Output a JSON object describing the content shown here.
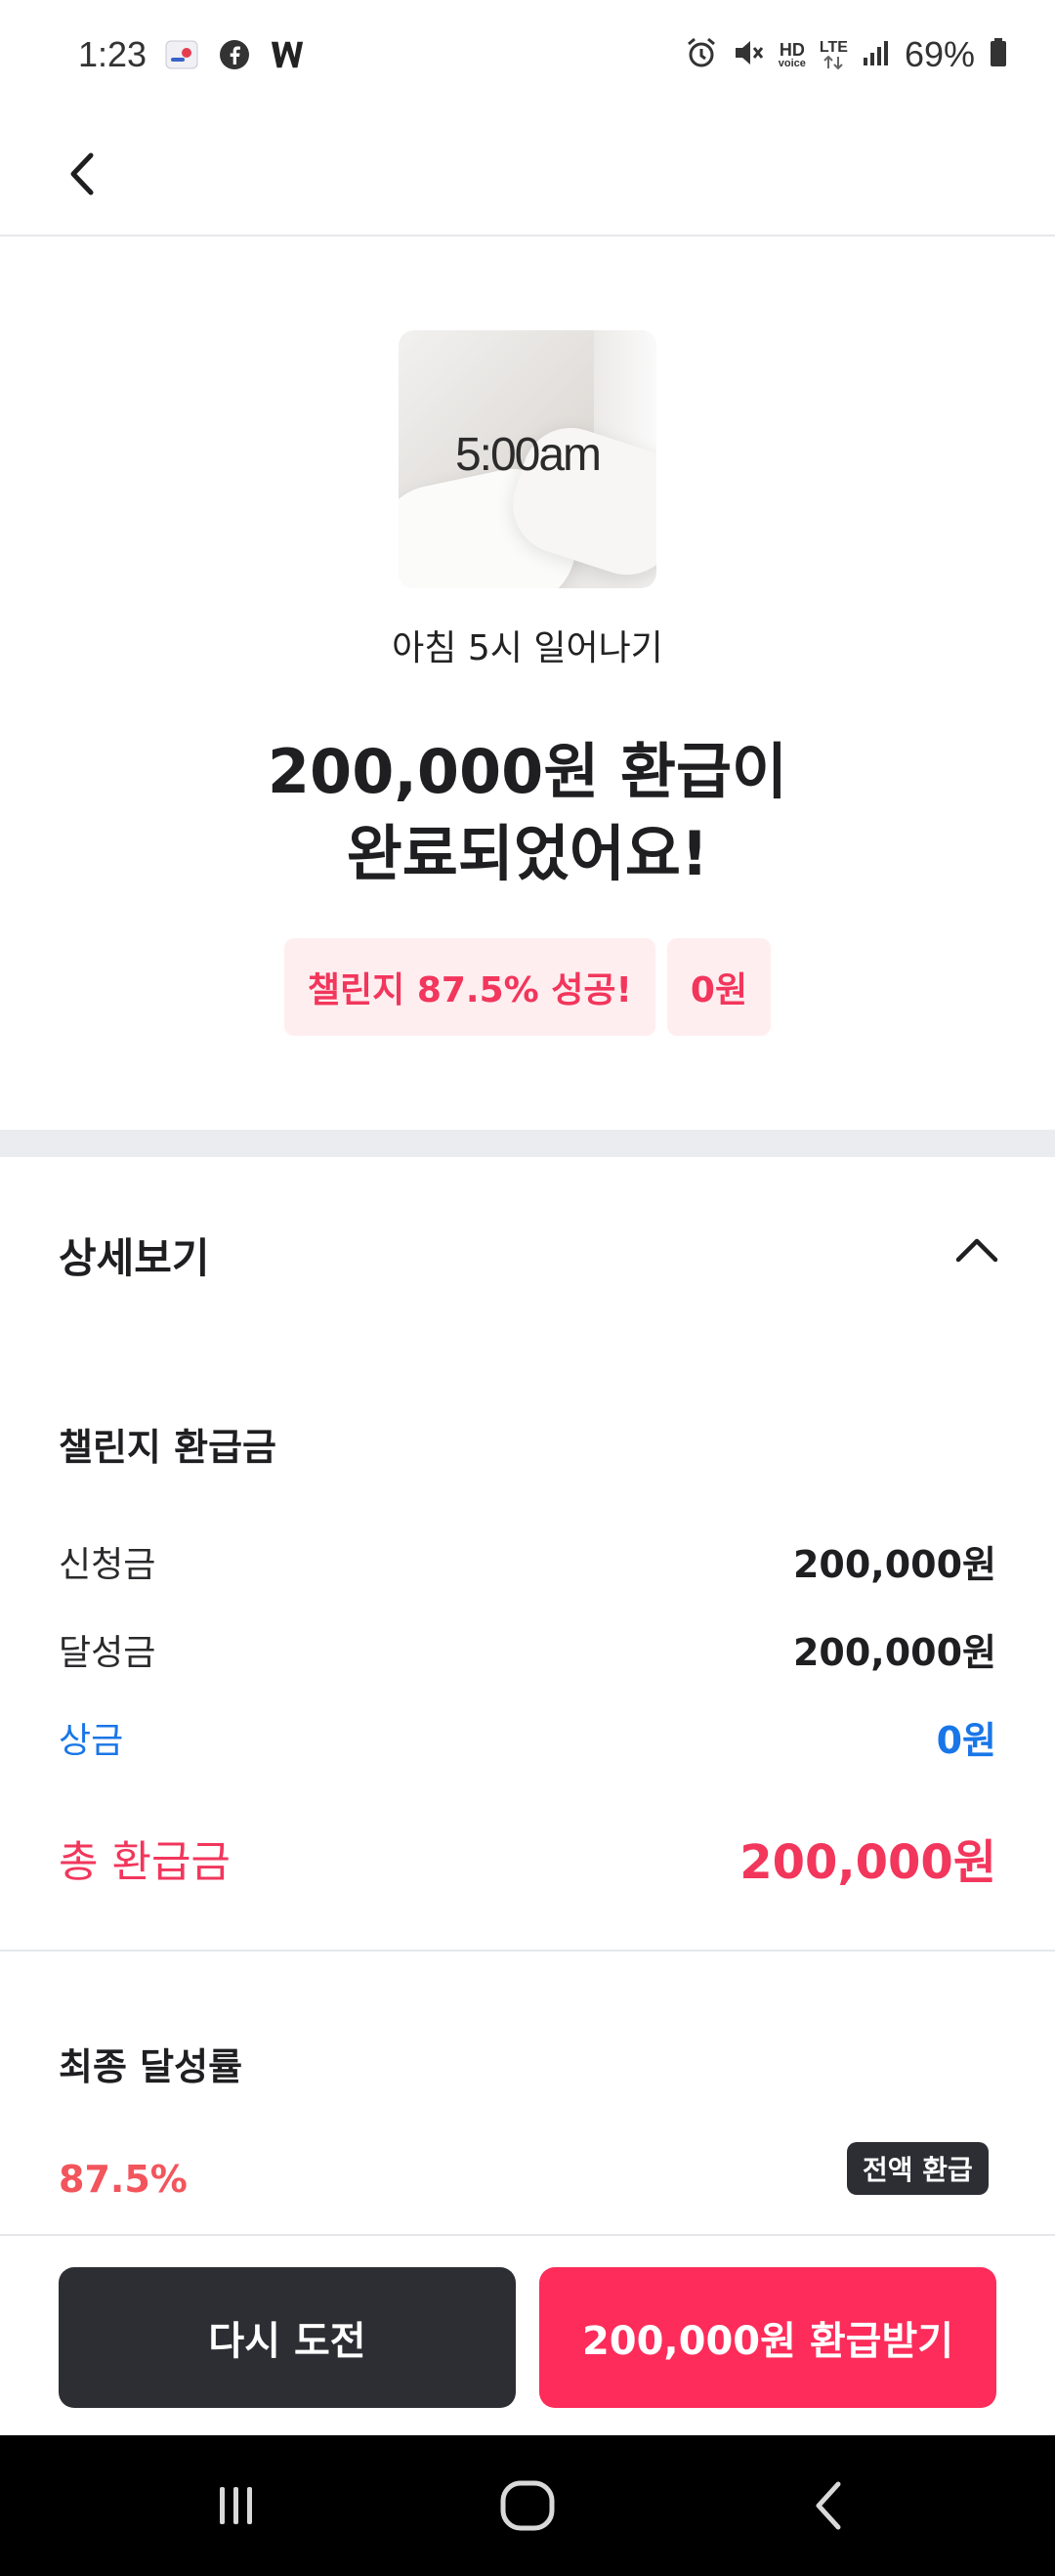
{
  "status_bar": {
    "time": "1:23",
    "battery": "69%",
    "hd_label": "HD",
    "voice_label": "voice",
    "lte_label": "LTE"
  },
  "hero": {
    "thumbnail_text": "5:00am",
    "challenge_name": "아침 5시 일어나기",
    "title_line1": "200,000원 환급이",
    "title_line2": "완료되었어요!",
    "badge_success": "챌린지 87.5% 성공!",
    "badge_amount": "0원"
  },
  "details": {
    "title": "상세보기",
    "refund_section_title": "챌린지 환급금",
    "rows": [
      {
        "label": "신청금",
        "value": "200,000원"
      },
      {
        "label": "달성금",
        "value": "200,000원"
      },
      {
        "label": "상금",
        "value": "0원"
      }
    ],
    "total_label": "총 환급금",
    "total_value": "200,000원",
    "rate_section_title": "최종 달성률",
    "rate_value": "87.5%",
    "rate_badge": "전액 환급"
  },
  "actions": {
    "retry_label": "다시 도전",
    "refund_label": "200,000원 환급받기"
  },
  "colors": {
    "accent_pink": "#fd2c5a",
    "accent_blue": "#1976e8",
    "dark_button": "#2c2e33"
  }
}
